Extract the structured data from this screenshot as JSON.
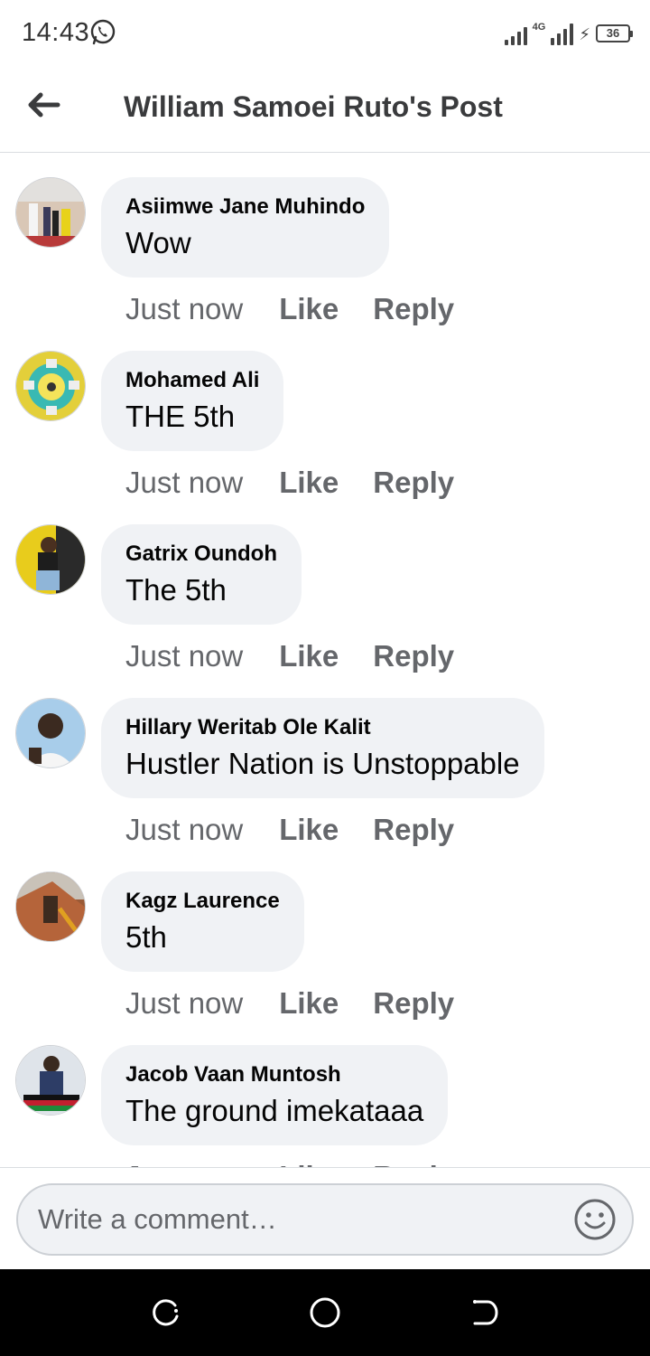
{
  "status_bar": {
    "time": "14:43",
    "network": "4G",
    "battery": "36",
    "icons": [
      "whatsapp-icon",
      "signal-icon",
      "charging-icon",
      "battery-icon"
    ]
  },
  "header": {
    "title": "William Samoei Ruto's Post",
    "back_icon": "arrow-left-icon"
  },
  "comments": [
    {
      "author": "Asiimwe Jane Muhindo",
      "text": "Wow",
      "time": "Just now",
      "like": "Like",
      "reply": "Reply",
      "avatar_color": "#c9a38b"
    },
    {
      "author": "Mohamed Ali",
      "text": "THE 5th",
      "time": "Just now",
      "like": "Like",
      "reply": "Reply",
      "avatar_color": "#d7c53c"
    },
    {
      "author": "Gatrix Oundoh",
      "text": "The 5th",
      "time": "Just now",
      "like": "Like",
      "reply": "Reply",
      "avatar_color": "#e4c21e"
    },
    {
      "author": "Hillary Weritab Ole Kalit",
      "text": "Hustler Nation is Unstoppable",
      "time": "Just now",
      "like": "Like",
      "reply": "Reply",
      "avatar_color": "#7fb2e0"
    },
    {
      "author": "Kagz Laurence",
      "text": "5th",
      "time": "Just now",
      "like": "Like",
      "reply": "Reply",
      "avatar_color": "#b3663e"
    },
    {
      "author": "Jacob Vaan Muntosh",
      "text": "The ground imekataaa",
      "time": "Just now",
      "like": "Like",
      "reply": "Reply",
      "avatar_color": "#6e7e92"
    }
  ],
  "composer": {
    "placeholder": "Write a comment…",
    "emoji_icon": "smiley-icon"
  },
  "nav_bar": {
    "icons": [
      "recent-apps-icon",
      "home-icon",
      "back-icon"
    ]
  }
}
